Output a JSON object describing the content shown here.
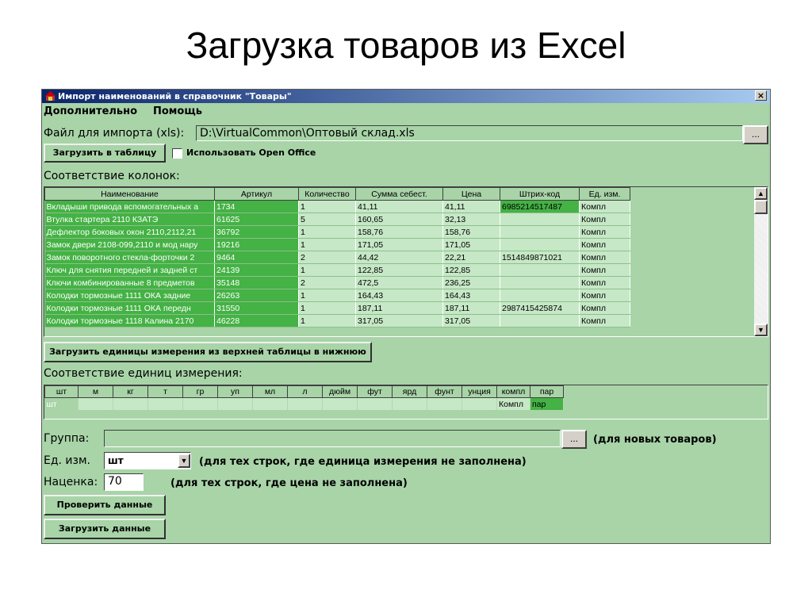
{
  "slide": {
    "title": "Загрузка товаров из Excel"
  },
  "window": {
    "title": "Импорт наименований в справочник \"Товары\"",
    "close_label": "×"
  },
  "menu": {
    "items": [
      "Дополнительно",
      "Помощь"
    ]
  },
  "import_file": {
    "label": "Файл для импорта (xls):",
    "value": "D:\\VirtualCommon\\Оптовый склад.xls",
    "browse_label": "..."
  },
  "load_table_button": "Загрузить в таблицу",
  "open_office": {
    "label": "Использовать Open Office",
    "checked": false
  },
  "columns_section": {
    "title": "Соответствие колонок:"
  },
  "products_table": {
    "headers": [
      "Наименование",
      "Артикул",
      "Количество",
      "Сумма себест.",
      "Цена",
      "Штрих-код",
      "Ед. изм."
    ],
    "rows": [
      [
        "Вкладыши привода вспомогательных а",
        "1734",
        "1",
        "41,11",
        "41,11",
        "6985214517487",
        "Компл"
      ],
      [
        "Втулка стартера 2110 КЗАТЭ",
        "61625",
        "5",
        "160,65",
        "32,13",
        "",
        "Компл"
      ],
      [
        "Дефлектор боковых окон 2110,2112,21",
        "36792",
        "1",
        "158,76",
        "158,76",
        "",
        "Компл"
      ],
      [
        "Замок двери 2108-099,2110 и мод нару",
        "19216",
        "1",
        "171,05",
        "171,05",
        "",
        "Компл"
      ],
      [
        "Замок поворотного стекла-форточки 2",
        "9464",
        "2",
        "44,42",
        "22,21",
        "1514849871021",
        "Компл"
      ],
      [
        "Ключ для снятия передней и задней ст",
        "24139",
        "1",
        "122,85",
        "122,85",
        "",
        "Компл"
      ],
      [
        "Ключи комбинированные  8 предметов",
        "35148",
        "2",
        "472,5",
        "236,25",
        "",
        "Компл"
      ],
      [
        "Колодки тормозные 1111 ОКА задние",
        "26263",
        "1",
        "164,43",
        "164,43",
        "",
        "Компл"
      ],
      [
        "Колодки тормозные 1111 ОКА передн",
        "31550",
        "1",
        "187,11",
        "187,11",
        "2987415425874",
        "Компл"
      ],
      [
        "Колодки тормозные 1118 Калина 2170",
        "46228",
        "1",
        "317,05",
        "317,05",
        "",
        "Компл"
      ]
    ]
  },
  "load_units_button": "Загрузить единицы измерения из верхней таблицы в нижнюю",
  "units_section": {
    "title": "Соответствие единиц измерения:",
    "headers": [
      "шт",
      "м",
      "кг",
      "т",
      "гр",
      "уп",
      "мл",
      "л",
      "дюйм",
      "фут",
      "ярд",
      "фунт",
      "унция",
      "компл",
      "пар"
    ],
    "values": [
      "шт",
      "",
      "",
      "",
      "",
      "",
      "",
      "",
      "",
      "",
      "",
      "",
      "",
      "Компл",
      "пар"
    ]
  },
  "group": {
    "label": "Группа:",
    "value": "",
    "browse_label": "...",
    "note": "(для новых товаров)"
  },
  "unit": {
    "label": "Ед. изм.",
    "value": "шт",
    "note": "(для тех строк, где единица измерения не заполнена)"
  },
  "markup": {
    "label": "Наценка:",
    "value": "70",
    "note": "(для тех строк, где цена не заполнена)"
  },
  "check_button": "Проверить данные",
  "load_button": "Загрузить данные",
  "colors": {
    "window_bg": "#a8d4a8",
    "highlight_green": "#44b244",
    "title_bar": "#0a246a"
  }
}
